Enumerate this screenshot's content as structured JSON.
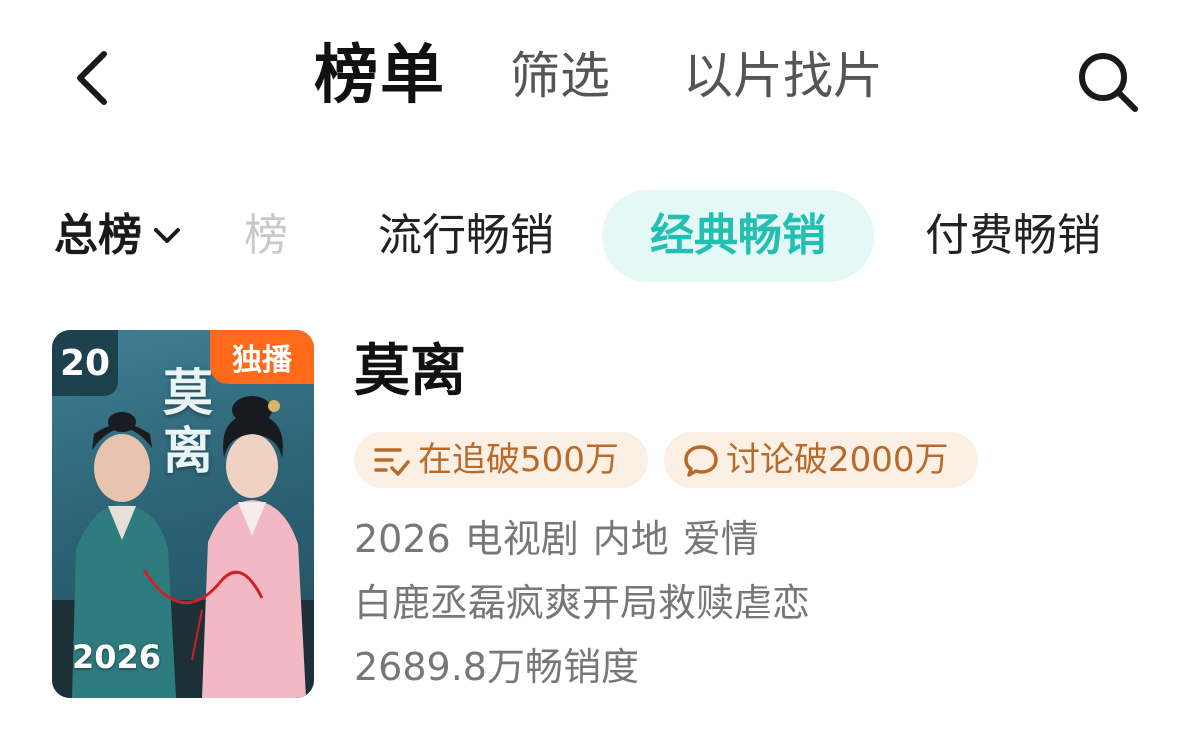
{
  "nav": {
    "title": "榜单",
    "tabs": [
      "筛选",
      "以片找片"
    ],
    "back_icon": "chevron-left-icon",
    "search_icon": "search-icon"
  },
  "categories": {
    "dropdown_label": "总榜",
    "faded_label": "榜",
    "tabs": [
      "流行畅销",
      "经典畅销",
      "付费畅销"
    ],
    "selected": "经典畅销"
  },
  "colors": {
    "accent_teal": "#22c0b3",
    "pill_bg": "#e4f8f6",
    "badge_orange": "#ff6a1a",
    "chip_bg": "#fcf0e5",
    "chip_text": "#b86a2a"
  },
  "item": {
    "rank": "20",
    "badge": "独播",
    "poster_title": "莫离",
    "poster_year": "2026",
    "title": "莫离",
    "stats": [
      {
        "icon": "follow-list-icon",
        "text": "在追破500万"
      },
      {
        "icon": "comment-bubble-icon",
        "text": "讨论破2000万"
      }
    ],
    "year": "2026",
    "genres": [
      "电视剧",
      "内地",
      "爱情"
    ],
    "description": "白鹿丞磊疯爽开局救赎虐恋",
    "sales": "2689.8万畅销度"
  }
}
